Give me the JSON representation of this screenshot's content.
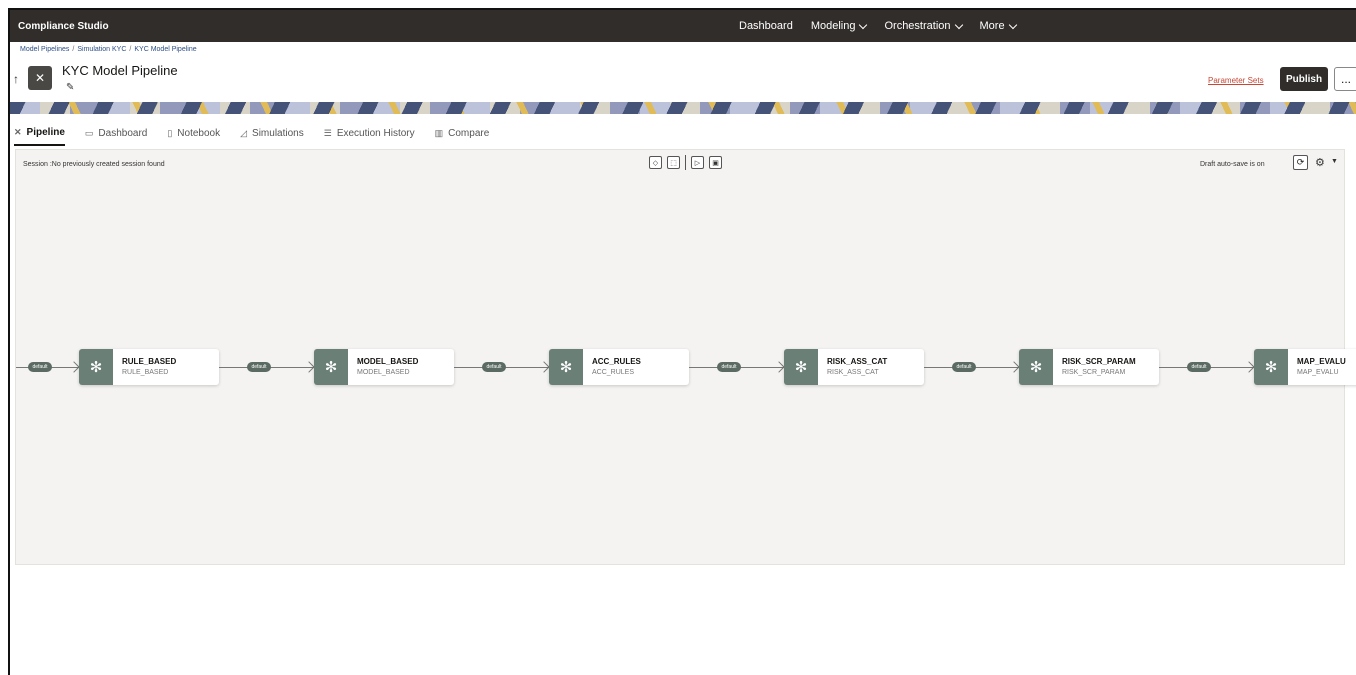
{
  "app": {
    "brand": "Compliance Studio"
  },
  "top_nav": [
    {
      "label": "Dashboard",
      "dropdown": false
    },
    {
      "label": "Modeling",
      "dropdown": true
    },
    {
      "label": "Orchestration",
      "dropdown": true
    },
    {
      "label": "More",
      "dropdown": true
    }
  ],
  "breadcrumb": [
    "Model Pipelines",
    "Simulation KYC",
    "KYC Model Pipeline"
  ],
  "header": {
    "title": "KYC Model Pipeline",
    "parameter_sets_label": "Parameter Sets",
    "publish_label": "Publish",
    "more_label": "..."
  },
  "tabs": [
    {
      "label": "Pipeline",
      "icon": "pipeline-icon",
      "active": true
    },
    {
      "label": "Dashboard",
      "icon": "dashboard-icon",
      "active": false
    },
    {
      "label": "Notebook",
      "icon": "notebook-icon",
      "active": false
    },
    {
      "label": "Simulations",
      "icon": "chart-icon",
      "active": false
    },
    {
      "label": "Execution History",
      "icon": "list-icon",
      "active": false
    },
    {
      "label": "Compare",
      "icon": "compare-icon",
      "active": false
    }
  ],
  "canvas": {
    "session_text": "Session :No previously created session found",
    "autosave_text": "Draft auto-save is on",
    "toolbar_icons": [
      "validate-icon",
      "select-icon",
      "run-icon",
      "save-icon"
    ]
  },
  "pipeline": {
    "connector_label": "default",
    "nodes": [
      {
        "name": "RULE_BASED",
        "sub": "RULE_BASED"
      },
      {
        "name": "MODEL_BASED",
        "sub": "MODEL_BASED"
      },
      {
        "name": "ACC_RULES",
        "sub": "ACC_RULES"
      },
      {
        "name": "RISK_ASS_CAT",
        "sub": "RISK_ASS_CAT"
      },
      {
        "name": "RISK_SCR_PARAM",
        "sub": "RISK_SCR_PARAM"
      },
      {
        "name": "MAP_EVALU",
        "sub": "MAP_EVALU"
      }
    ]
  },
  "colors": {
    "topbar": "#312d2a",
    "node_icon": "#6a7f76",
    "link": "#c74634",
    "canvas": "#f4f3f1"
  }
}
